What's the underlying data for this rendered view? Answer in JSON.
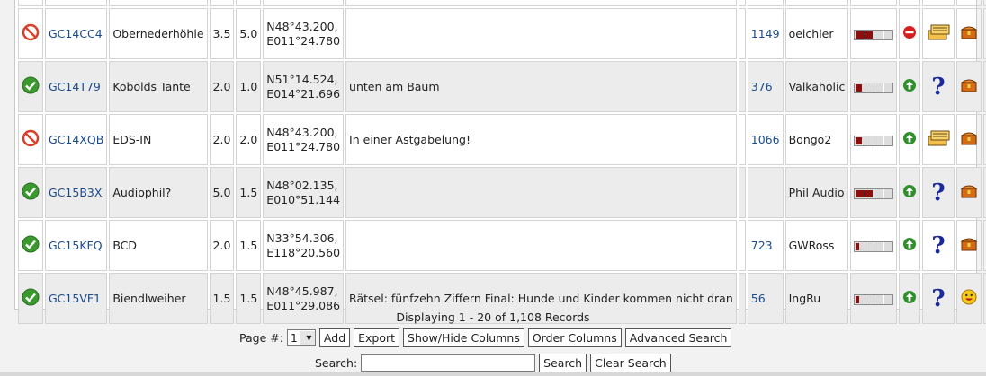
{
  "rows": [
    {
      "status": "archived",
      "code": "GC14CC4",
      "name": "Obernederhöhle",
      "difficulty": "3.5",
      "terrain": "5.0",
      "coord1": "N48°43.200,",
      "coord2": "E011°24.780",
      "hint": "",
      "num": "1149",
      "owner": "oeichler",
      "size_fill": 0.45,
      "type_icon": "no-entry-icon",
      "cache_icon": "multi-cache-icon",
      "box_icon": "treasure-chest-icon"
    },
    {
      "status": "active",
      "code": "GC14T79",
      "name": "Kobolds Tante",
      "difficulty": "2.0",
      "terrain": "1.0",
      "coord1": "N51°14.524,",
      "coord2": "E014°21.696",
      "hint": "unten am Baum",
      "num": "376",
      "owner": "Valkaholic",
      "size_fill": 0.15,
      "type_icon": "green-arrow-icon",
      "cache_icon": "mystery-cache-icon",
      "box_icon": "treasure-chest-icon"
    },
    {
      "status": "archived",
      "code": "GC14XQB",
      "name": "EDS-IN",
      "difficulty": "2.0",
      "terrain": "2.0",
      "coord1": "N48°43.200,",
      "coord2": "E011°24.780",
      "hint": "In einer Astgabelung!",
      "num": "1066",
      "owner": "Bongo2",
      "size_fill": 0.15,
      "type_icon": "green-arrow-icon",
      "cache_icon": "multi-cache-icon",
      "box_icon": "treasure-chest-icon"
    },
    {
      "status": "active",
      "code": "GC15B3X",
      "name": "Audiophil?",
      "difficulty": "5.0",
      "terrain": "1.5",
      "coord1": "N48°02.135,",
      "coord2": "E010°51.144",
      "hint": "",
      "num": "",
      "owner": "Phil Audio",
      "size_fill": 0.45,
      "type_icon": "green-arrow-icon",
      "cache_icon": "mystery-cache-icon",
      "box_icon": "treasure-chest-icon"
    },
    {
      "status": "active",
      "code": "GC15KFQ",
      "name": "BCD",
      "difficulty": "2.0",
      "terrain": "1.5",
      "coord1": "N33°54.306,",
      "coord2": "E118°20.560",
      "hint": "",
      "num": "723",
      "owner": "GWRoss",
      "size_fill": 0.08,
      "type_icon": "green-arrow-icon",
      "cache_icon": "mystery-cache-icon",
      "box_icon": "treasure-chest-icon"
    },
    {
      "status": "active",
      "code": "GC15VF1",
      "name": "Biendlweiher",
      "difficulty": "1.5",
      "terrain": "1.5",
      "coord1": "N48°45.987,",
      "coord2": "E011°29.086",
      "hint": "Rätsel: fünfzehn Ziffern Final: Hunde und Kinder kommen nicht dran",
      "num": "56",
      "owner": "IngRu",
      "size_fill": 0.08,
      "type_icon": "green-arrow-icon",
      "cache_icon": "mystery-cache-icon",
      "box_icon": "smiley-icon"
    }
  ],
  "footer": {
    "displaying": "Displaying 1 - 20 of 1,108 Records",
    "page_label": "Page #:",
    "page_value": "1",
    "add_label": "Add",
    "export_label": "Export",
    "showhide_label": "Show/Hide Columns",
    "order_label": "Order Columns",
    "advanced_label": "Advanced Search",
    "search_label": "Search:",
    "search_value": "",
    "search_button": "Search",
    "clear_button": "Clear Search"
  }
}
